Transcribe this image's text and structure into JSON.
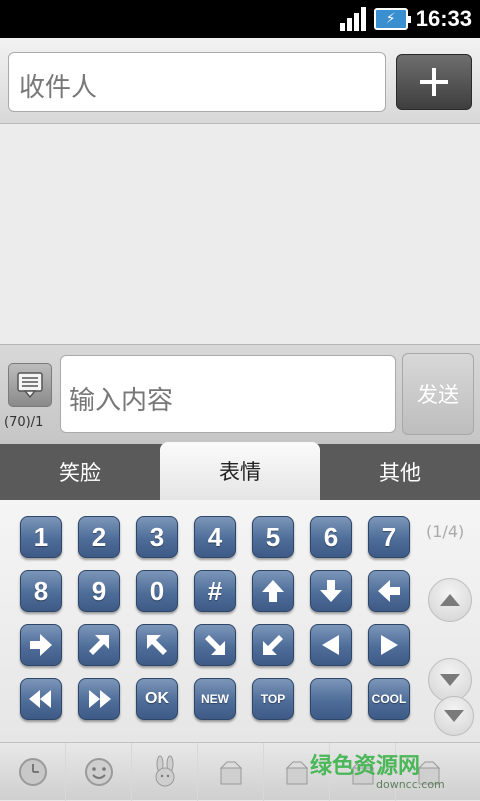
{
  "status_bar": {
    "time": "16:33"
  },
  "recipient": {
    "placeholder": "收件人"
  },
  "compose": {
    "placeholder": "输入内容",
    "counter": "(70)/1",
    "send_label": "发送"
  },
  "tabs": [
    {
      "label": "笑脸",
      "active": false
    },
    {
      "label": "表情",
      "active": true
    },
    {
      "label": "其他",
      "active": false
    }
  ],
  "emoji_panel": {
    "page_indicator": "(1/4)",
    "rows": [
      [
        "1",
        "2",
        "3",
        "4",
        "5",
        "6",
        "7"
      ],
      [
        "8",
        "9",
        "0",
        "#",
        "arrow-up",
        "arrow-down",
        "arrow-left"
      ],
      [
        "arrow-right",
        "arrow-up-right",
        "arrow-up-left",
        "arrow-down-right",
        "arrow-down-left",
        "triangle-left",
        "triangle-right"
      ],
      [
        "rewind",
        "fast-forward",
        "OK",
        "NEW",
        "TOP",
        "",
        "COOL"
      ]
    ]
  },
  "bottom_categories": [
    "clock-icon",
    "smiley-icon",
    "rabbit-icon",
    "box-icon",
    "box-icon",
    "box-icon",
    "box-icon"
  ],
  "watermark": {
    "title": "绿色资源网",
    "url": "downcc.com"
  },
  "colors": {
    "key_blue": "#4e6d98",
    "tab_bar": "#5a5a5a",
    "watermark_green": "#3bb34a"
  }
}
